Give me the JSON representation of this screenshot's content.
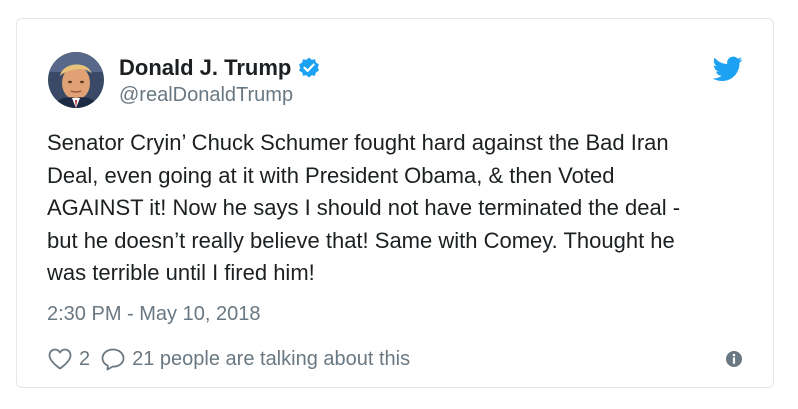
{
  "tweet": {
    "author": {
      "name": "Donald J. Trump",
      "handle": "@realDonaldTrump",
      "verified": true
    },
    "text": "Senator Cryin’ Chuck Schumer fought hard against the Bad Iran\nDeal, even going at it with President Obama, & then Voted\nAGAINST it! Now he says I should not have terminated the deal -\nbut he doesn’t really believe that! Same with Comey. Thought he\nwas terrible until I fired him!",
    "timestamp": "2:30 PM - May 10, 2018",
    "likes": "2",
    "replies_text": "21 people are talking about this"
  },
  "icons": {
    "verified": "verified-badge-icon",
    "brand": "twitter-bird-icon",
    "like": "heart-icon",
    "reply": "speech-bubble-icon",
    "info": "info-icon"
  },
  "colors": {
    "brand": "#1da1f2",
    "text": "#1c2022",
    "muted": "#697882",
    "border": "#e1e8ed"
  }
}
